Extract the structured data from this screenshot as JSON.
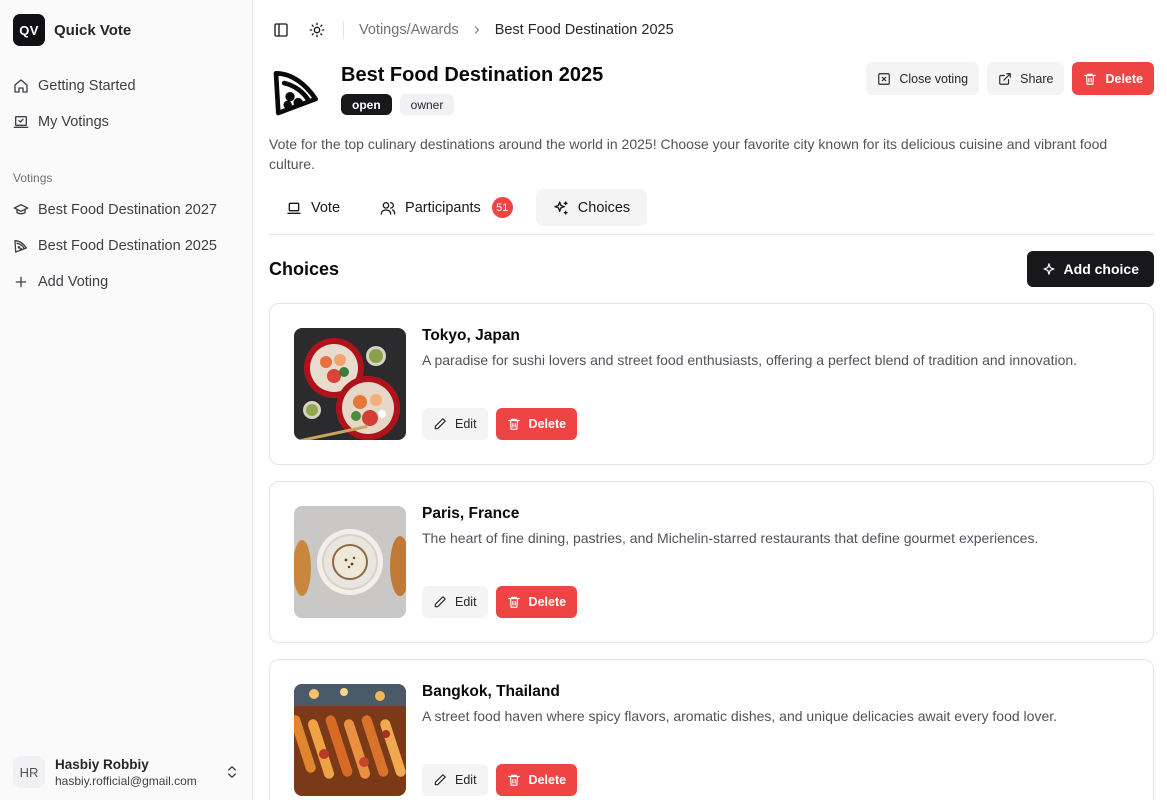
{
  "app": {
    "logo_text": "QV",
    "name": "Quick Vote"
  },
  "sidebar": {
    "items": [
      {
        "label": "Getting Started",
        "icon": "home-icon"
      },
      {
        "label": "My Votings",
        "icon": "ballot-icon"
      }
    ],
    "group_label": "Votings",
    "votings": [
      {
        "label": "Best Food Destination 2027",
        "icon": "graduation-cap-icon"
      },
      {
        "label": "Best Food Destination 2025",
        "icon": "pizza-icon"
      },
      {
        "label": "Add Voting",
        "icon": "plus-icon"
      }
    ]
  },
  "user": {
    "initials": "HR",
    "name": "Hasbiy Robbiy",
    "email": "hasbiy.rofficial@gmail.com"
  },
  "breadcrumb": {
    "parent": "Votings/Awards",
    "current": "Best Food Destination 2025"
  },
  "voting": {
    "title": "Best Food Destination 2025",
    "badges": [
      "open",
      "owner"
    ],
    "description": "Vote for the top culinary destinations around the world in 2025! Choose your favorite city known for its delicious cuisine and vibrant food culture."
  },
  "actions": {
    "close_voting": "Close voting",
    "share": "Share",
    "delete": "Delete"
  },
  "tabs": [
    {
      "label": "Vote"
    },
    {
      "label": "Participants",
      "count": "51"
    },
    {
      "label": "Choices",
      "active": true
    }
  ],
  "choices_section": {
    "title": "Choices",
    "add_label": "Add choice",
    "edit_label": "Edit",
    "delete_label": "Delete",
    "items": [
      {
        "name": "Tokyo, Japan",
        "description": "A paradise for sushi lovers and street food enthusiasts, offering a perfect blend of tradition and innovation."
      },
      {
        "name": "Paris, France",
        "description": "The heart of fine dining, pastries, and Michelin-starred restaurants that define gourmet experiences."
      },
      {
        "name": "Bangkok, Thailand",
        "description": "A street food haven where spicy flavors, aromatic dishes, and unique delicacies await every food lover."
      }
    ]
  },
  "colors": {
    "accent_red": "#ef4444",
    "primary_dark": "#18181b",
    "muted_bg": "#f4f4f5"
  }
}
